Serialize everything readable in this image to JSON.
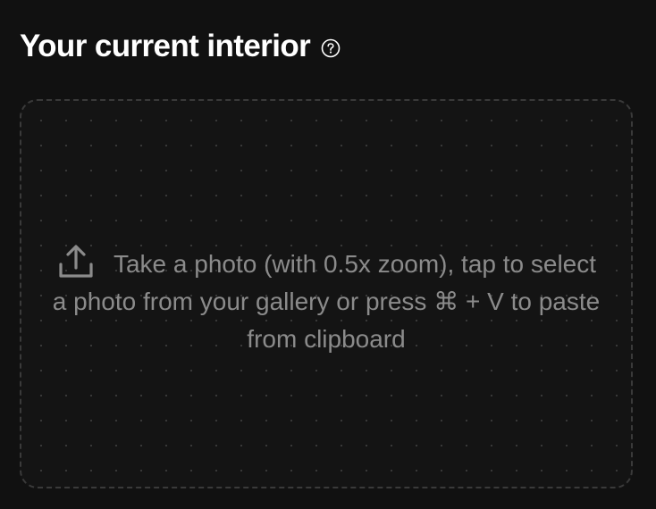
{
  "header": {
    "title": "Your current interior",
    "help_icon": "question-circle-icon"
  },
  "dropzone": {
    "upload_icon": "upload-icon",
    "prompt": "Take a photo (with 0.5x zoom), tap to select a photo from your gallery or press ⌘ + V to paste from clipboard"
  },
  "colors": {
    "background": "#111111",
    "title": "#ffffff",
    "prompt_text": "#8b8b8b",
    "dropzone_border": "#3a3a3a"
  }
}
